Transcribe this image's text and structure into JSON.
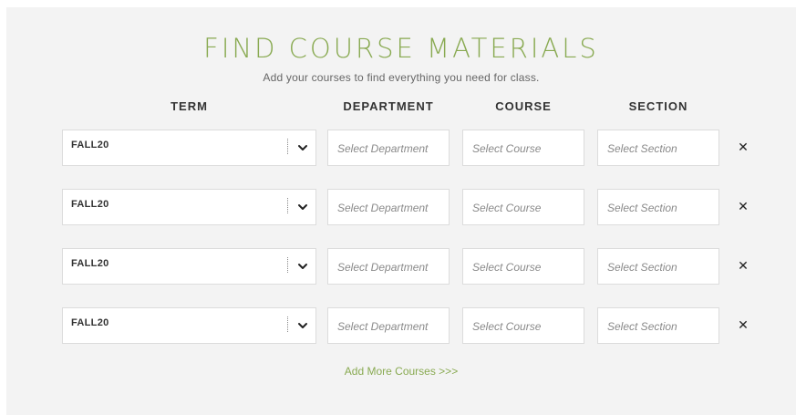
{
  "header": {
    "title": "FIND COURSE MATERIALS",
    "subtitle": "Add your courses to find everything you need for class."
  },
  "columns": {
    "term": "TERM",
    "department": "DEPARTMENT",
    "course": "COURSE",
    "section": "SECTION"
  },
  "rows": [
    {
      "term": "FALL20",
      "department_placeholder": "Select Department",
      "course_placeholder": "Select Course",
      "section_placeholder": "Select Section",
      "remove": "✕"
    },
    {
      "term": "FALL20",
      "department_placeholder": "Select Department",
      "course_placeholder": "Select Course",
      "section_placeholder": "Select Section",
      "remove": "✕"
    },
    {
      "term": "FALL20",
      "department_placeholder": "Select Department",
      "course_placeholder": "Select Course",
      "section_placeholder": "Select Section",
      "remove": "✕"
    },
    {
      "term": "FALL20",
      "department_placeholder": "Select Department",
      "course_placeholder": "Select Course",
      "section_placeholder": "Select Section",
      "remove": "✕"
    }
  ],
  "footer": {
    "add_more": "Add More Courses >>>"
  },
  "colors": {
    "accent": "#89aa52",
    "panel_bg": "#f3f3f3"
  },
  "icons": {
    "dropdown": "chevron-down-icon",
    "remove": "close-icon"
  }
}
